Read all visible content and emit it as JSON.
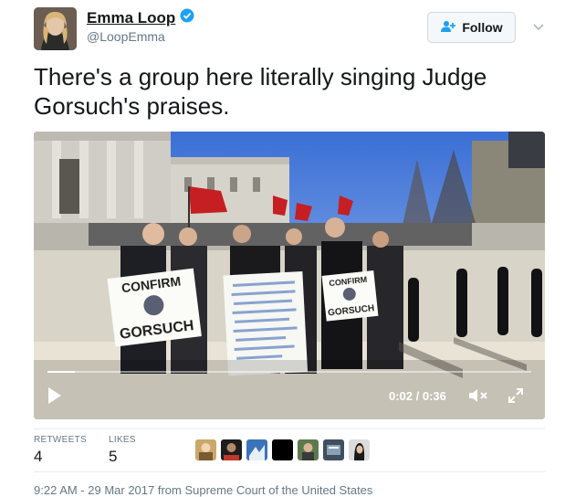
{
  "author": {
    "name": "Emma Loop",
    "handle": "@LoopEmma",
    "verified": true,
    "verified_color": "#1da1f2"
  },
  "follow_button": {
    "label": "Follow",
    "icon": "add-user-icon"
  },
  "tweet": {
    "text": "There's a group here literally singing Judge Gorsuch's praises."
  },
  "video": {
    "time_display": "0:02 / 0:36",
    "progress": 0.056,
    "sign_left": {
      "top": "CONFIRM",
      "bottom": "GORSUCH"
    },
    "sign_right": {
      "top": "CONFIRM",
      "bottom": "GORSUCH"
    }
  },
  "stats": {
    "retweets_label": "RETWEETS",
    "retweets_value": "4",
    "likes_label": "LIKES",
    "likes_value": "5"
  },
  "timestamp": "9:22 AM - 29 Mar 2017 from Supreme Court of the United States"
}
